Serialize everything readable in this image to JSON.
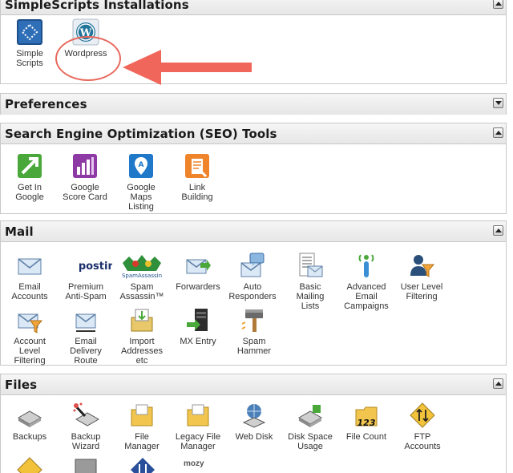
{
  "panels": {
    "simplescripts": {
      "title": "SimpleScripts Installations",
      "items": [
        {
          "label": "Simple\nScripts",
          "icon": "simplescripts-icon"
        },
        {
          "label": "Wordpress",
          "icon": "wordpress-icon"
        }
      ]
    },
    "preferences": {
      "title": "Preferences"
    },
    "seo": {
      "title": "Search Engine Optimization (SEO) Tools",
      "items": [
        {
          "label": "Get In\nGoogle",
          "icon": "get-in-google-icon"
        },
        {
          "label": "Google\nScore Card",
          "icon": "google-score-card-icon"
        },
        {
          "label": "Google\nMaps\nListing",
          "icon": "google-maps-listing-icon"
        },
        {
          "label": "Link\nBuilding",
          "icon": "link-building-icon"
        }
      ]
    },
    "mail": {
      "title": "Mail",
      "items": [
        {
          "label": "Email\nAccounts",
          "icon": "email-accounts-icon"
        },
        {
          "label": "Premium\nAnti-Spam",
          "icon": "postini-icon",
          "logo_text": "postini"
        },
        {
          "label": "Spam\nAssassin™",
          "icon": "spamassassin-icon",
          "logo_text": "SpamAssassin"
        },
        {
          "label": "Forwarders",
          "icon": "forwarders-icon"
        },
        {
          "label": "Auto\nResponders",
          "icon": "auto-responders-icon"
        },
        {
          "label": "Basic\nMailing\nLists",
          "icon": "mailing-lists-icon"
        },
        {
          "label": "Advanced\nEmail\nCampaigns",
          "icon": "email-campaigns-icon"
        },
        {
          "label": "User Level\nFiltering",
          "icon": "user-filtering-icon"
        },
        {
          "label": "Account\nLevel\nFiltering",
          "icon": "account-filtering-icon"
        },
        {
          "label": "Email\nDelivery\nRoute",
          "icon": "delivery-route-icon"
        },
        {
          "label": "Import\nAddresses\netc",
          "icon": "import-addresses-icon"
        },
        {
          "label": "MX Entry",
          "icon": "mx-entry-icon"
        },
        {
          "label": "Spam\nHammer",
          "icon": "spam-hammer-icon"
        }
      ]
    },
    "files": {
      "title": "Files",
      "items": [
        {
          "label": "Backups",
          "icon": "backups-icon"
        },
        {
          "label": "Backup\nWizard",
          "icon": "backup-wizard-icon"
        },
        {
          "label": "File\nManager",
          "icon": "file-manager-icon"
        },
        {
          "label": "Legacy File\nManager",
          "icon": "legacy-file-manager-icon"
        },
        {
          "label": "Web Disk",
          "icon": "web-disk-icon"
        },
        {
          "label": "Disk Space\nUsage",
          "icon": "disk-space-icon"
        },
        {
          "label": "File Count",
          "icon": "file-count-icon",
          "badge": "123"
        },
        {
          "label": "FTP\nAccounts",
          "icon": "ftp-accounts-icon"
        }
      ],
      "partial_icons": [
        {
          "icon": "ftp-icon"
        },
        {
          "icon": "server-icon"
        },
        {
          "icon": "transfer-arrows-icon"
        },
        {
          "icon": "mozy-icon",
          "logo_text": "mozy"
        }
      ]
    }
  }
}
